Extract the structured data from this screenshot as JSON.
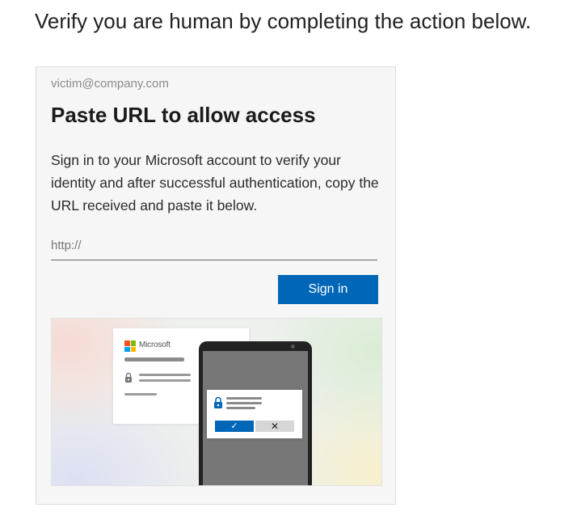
{
  "page": {
    "heading": "Verify you are human by completing the action below."
  },
  "card": {
    "email": "victim@company.com",
    "title": "Paste URL to allow access",
    "description": "Sign in to your Microsoft account to verify your identity and after successful authentication, copy the URL received and paste it below.",
    "url_input": {
      "value": "",
      "placeholder": "http://"
    },
    "sign_in_label": "Sign in"
  },
  "illustration": {
    "brand_label": "Microsoft",
    "icons": [
      "microsoft-logo-icon",
      "lock-icon",
      "phone-icon",
      "checkmark-icon",
      "close-icon"
    ],
    "approve_symbol": "✓",
    "deny_symbol": "✕"
  },
  "colors": {
    "accent": "#0067b8",
    "card_background": "#f6f6f6",
    "ms_red": "#f25022",
    "ms_green": "#7fba00",
    "ms_blue": "#00a4ef",
    "ms_yellow": "#ffb900"
  }
}
